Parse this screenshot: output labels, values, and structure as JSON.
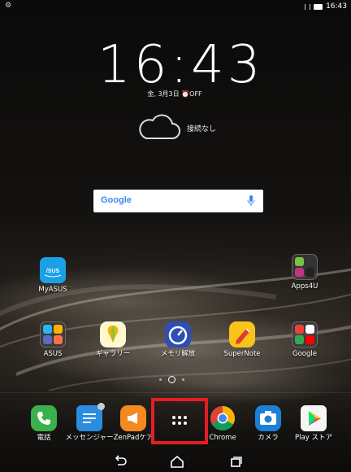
{
  "status_bar": {
    "time": "16:43",
    "left_icon": "settings-icon"
  },
  "clock_widget": {
    "time": "16:43",
    "date": "金, 3月3日",
    "alarm": "OFF",
    "weather_text": "接続なし"
  },
  "search": {
    "logo": "Google"
  },
  "home_apps": [
    {
      "label": "MyASUS"
    },
    {
      "label": "Apps4U"
    },
    {
      "label": "ASUS"
    },
    {
      "label": "ギャラリー"
    },
    {
      "label": "メモリ解放"
    },
    {
      "label": "SuperNote"
    },
    {
      "label": "Google"
    }
  ],
  "dock": [
    {
      "label": "電話"
    },
    {
      "label": "メッセンジャー"
    },
    {
      "label": "ZenPadケア"
    },
    {
      "label": ""
    },
    {
      "label": "Chrome"
    },
    {
      "label": "カメラ"
    },
    {
      "label": "Play ストア"
    }
  ],
  "colors": {
    "highlight": "#e31e24",
    "phone": "#3ab14a",
    "messenger": "#2a8de0",
    "zenpad": "#f4891f"
  }
}
